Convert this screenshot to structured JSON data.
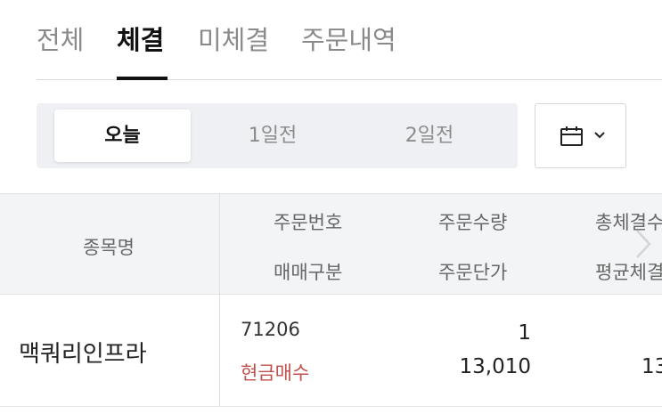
{
  "tabs": [
    {
      "label": "전체",
      "active": false
    },
    {
      "label": "체결",
      "active": true
    },
    {
      "label": "미체결",
      "active": false
    },
    {
      "label": "주문내역",
      "active": false
    }
  ],
  "day_filter": {
    "options": [
      "오늘",
      "1일전",
      "2일전"
    ],
    "selected": "오늘"
  },
  "date_picker": {
    "icon": "calendar-icon",
    "dropdown_icon": "chevron-down-icon"
  },
  "table": {
    "headers": {
      "name": "종목명",
      "order_no": "주문번호",
      "trade_type": "매매구분",
      "order_qty": "주문수량",
      "order_price": "주문단가",
      "total_filled_qty": "총체결수",
      "avg_filled_price": "평균체결"
    },
    "rows": [
      {
        "name": "맥쿼리인프라",
        "order_no": "71206",
        "trade_type": "현금매수",
        "order_qty": "1",
        "order_price": "13,010",
        "avg_filled_price": "13"
      }
    ]
  },
  "colors": {
    "buy": "#c0504d",
    "active_text": "#111111",
    "inactive_text": "#8a8a8a",
    "header_bg": "#f3f4f6",
    "segment_bg": "#eef0f3"
  }
}
